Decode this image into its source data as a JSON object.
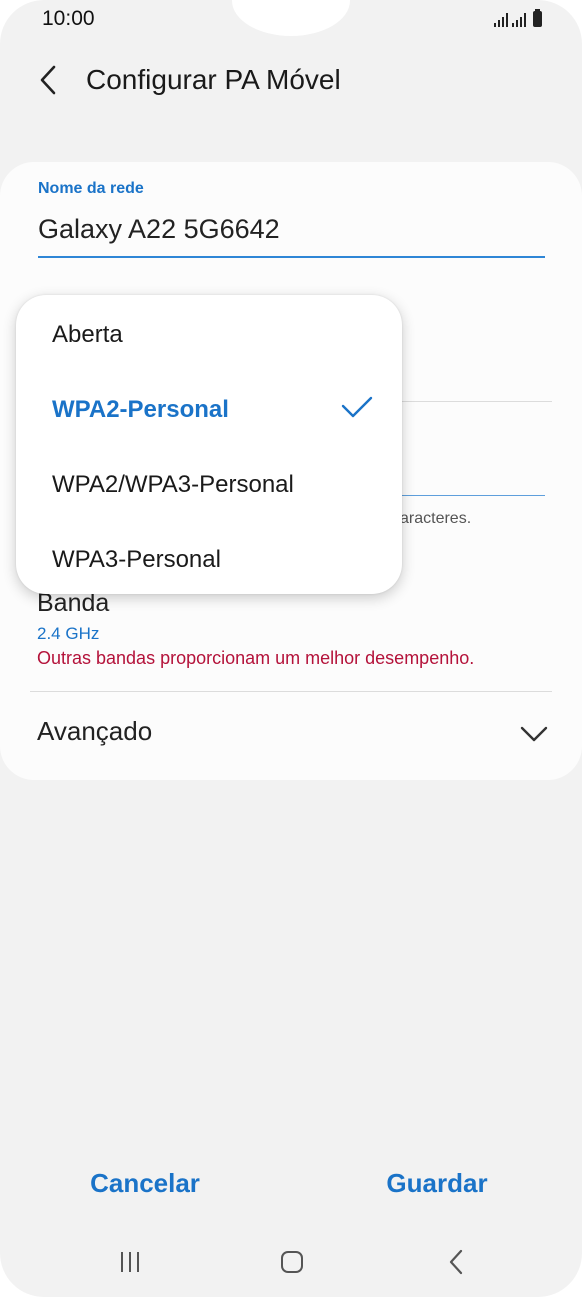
{
  "status_bar": {
    "time": "10:00",
    "icons": [
      "signal-icon",
      "signal-icon",
      "battery-icon"
    ]
  },
  "header": {
    "back_icon": "chevron-left-icon",
    "title": "Configurar PA Móvel"
  },
  "network_name": {
    "label": "Nome da rede",
    "value": "Galaxy A22 5G6642"
  },
  "password_hint_tail": "aracteres.",
  "security_dropdown": {
    "options": [
      {
        "label": "Aberta",
        "selected": false
      },
      {
        "label": "WPA2-Personal",
        "selected": true
      },
      {
        "label": "WPA2/WPA3-Personal",
        "selected": false
      },
      {
        "label": "WPA3-Personal",
        "selected": false
      }
    ],
    "check_icon": "check-icon"
  },
  "band": {
    "label": "Banda",
    "value": "2.4 GHz",
    "warning": "Outras bandas proporcionam um melhor desempenho."
  },
  "advanced": {
    "label": "Avançado",
    "icon": "chevron-down-icon"
  },
  "actions": {
    "cancel": "Cancelar",
    "save": "Guardar"
  },
  "nav_bar": {
    "icons": [
      "recent-apps-icon",
      "home-icon",
      "back-icon"
    ]
  },
  "colors": {
    "accent": "#1a73c8",
    "warning": "#b4123a",
    "background": "#f2f2f2",
    "card": "#fcfcfc"
  }
}
